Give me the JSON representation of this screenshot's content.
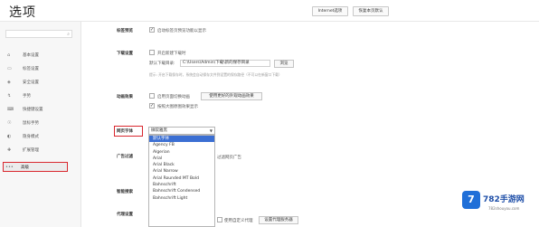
{
  "header": {
    "title": "选项",
    "ie_button": "Internet选项",
    "reset_button": "恢复本页默认"
  },
  "sidebar": {
    "search_placeholder": "",
    "items": [
      {
        "label": "基本设置",
        "icon": "home-icon"
      },
      {
        "label": "标签设置",
        "icon": "tab-icon"
      },
      {
        "label": "安全设置",
        "icon": "shield-icon"
      },
      {
        "label": "手势",
        "icon": "gesture-icon"
      },
      {
        "label": "快捷键设置",
        "icon": "keyboard-icon"
      },
      {
        "label": "鼠标手势",
        "icon": "mouse-icon"
      },
      {
        "label": "隐身模式",
        "icon": "privacy-icon"
      },
      {
        "label": "扩展管理",
        "icon": "extension-icon"
      },
      {
        "label": "高级",
        "icon": "more-icon",
        "active": true
      }
    ]
  },
  "main": {
    "row_tab": {
      "label": "标签预览",
      "option": "启动标签页预览功能以显示"
    },
    "row_download": {
      "label": "下载设置",
      "option": "开启新建下载时",
      "path_label": "默认下载目录:",
      "path_value": "C:\\Users\\Admin\\下载\\新的保存目录",
      "change_button": "浏览",
      "note": "提示: 开启下载保存时，系统会自动保存文件到设置的保存路径（不可以在新窗口下载）"
    },
    "row_animation": {
      "label": "动画效果",
      "option1": "启用页面切换动画",
      "apply_button": "使用更好的外观动画效果",
      "option2": "按照大图原图效果显示"
    },
    "row_font": {
      "label": "网页字体",
      "select_value": "微软雅黑",
      "dropdown": [
        "默认字体",
        "Agency FB",
        "Algerian",
        "Arial",
        "Arial Black",
        "Arial Narrow",
        "Arial Rounded MT Bold",
        "Bahnschrift",
        "Bahnschrift Condensed",
        "Bahnschrift Light"
      ]
    },
    "row_ad": {
      "label": "广告过滤",
      "side_text": "过滤网页广告"
    },
    "row_smart": {
      "label": "智能搜索"
    },
    "row_proxy": {
      "label": "代理设置",
      "option": "使用自定义代理",
      "button": "设置代理服务器"
    }
  },
  "watermark": {
    "logo_letter": "7",
    "text": "782手游网",
    "url": "782shouyou.com"
  }
}
